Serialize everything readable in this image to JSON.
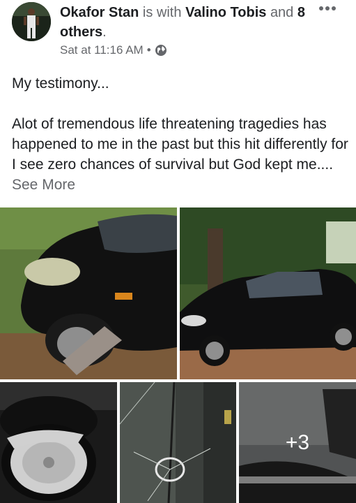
{
  "post": {
    "author": "Okafor Stan",
    "with_text": "is with",
    "tagged": "Valino Tobis",
    "and_text": "and",
    "others": "8 others",
    "period": ".",
    "time": "Sat at 11:16 AM",
    "dot": "•",
    "privacy_icon": "globe-icon",
    "more_icon": "more-options-icon"
  },
  "body": {
    "title": "My testimony...",
    "paragraph": "Alot of  tremendous life threatening tragedies has happened to me in the past but this hit differently for I see zero chances of survival but God kept me....",
    "see_more": "See More"
  },
  "photos": {
    "count_overlay": "+3"
  }
}
